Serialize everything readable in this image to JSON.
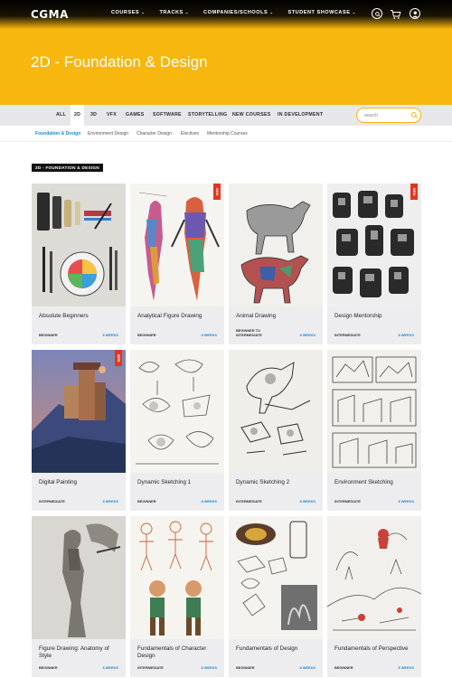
{
  "header": {
    "logo": "CGMA",
    "nav": [
      "COURSES",
      "TRACKS",
      "COMPANIES/SCHOOLS",
      "STUDENT SHOWCASE"
    ]
  },
  "hero": {
    "title": "2D - Foundation & Design"
  },
  "tabs": [
    "ALL",
    "2D",
    "3D",
    "VFX",
    "GAMES",
    "SOFTWARE",
    "STORYTELLING",
    "NEW COURSES",
    "IN DEVELOPMENT"
  ],
  "active_tab": "2D",
  "search": {
    "placeholder": "search"
  },
  "subtabs": [
    "Foundation & Design",
    "Environment Design",
    "Character Design",
    "Electives",
    "Mentorship Courses"
  ],
  "section_label": "2D - FOUNDATION & DESIGN",
  "badge_new": "NEW",
  "colors": {
    "accent": "#f8b70e",
    "link": "#1a8ad6",
    "new_badge": "#e5351f"
  },
  "courses": [
    {
      "title": "Absolute Beginners",
      "level": "BEGINNER",
      "duration": "8 WEEKS",
      "new": false
    },
    {
      "title": "Analytical Figure Drawing",
      "level": "BEGINNER",
      "duration": "8 WEEKS",
      "new": true
    },
    {
      "title": "Animal Drawing",
      "level": "BEGINNER TO INTERMEDIATE",
      "duration": "8 WEEKS",
      "new": false
    },
    {
      "title": "Design Mentorship",
      "level": "INTERMEDIATE",
      "duration": "8 WEEKS",
      "new": true
    },
    {
      "title": "Digital Painting",
      "level": "INTERMEDIATE",
      "duration": "8 WEEKS",
      "new": true
    },
    {
      "title": "Dynamic Sketching 1",
      "level": "BEGINNER",
      "duration": "8 WEEKS",
      "new": false
    },
    {
      "title": "Dynamic Sketching 2",
      "level": "INTERMEDIATE",
      "duration": "8 WEEKS",
      "new": false
    },
    {
      "title": "Environment Sketching",
      "level": "INTERMEDIATE",
      "duration": "8 WEEKS",
      "new": false
    },
    {
      "title": "Figure Drawing: Anatomy of Style",
      "level": "BEGINNER",
      "duration": "8 WEEKS",
      "new": false
    },
    {
      "title": "Fundamentals of Character Design",
      "level": "INTERMEDIATE",
      "duration": "8 WEEKS",
      "new": false
    },
    {
      "title": "Fundamentals of Design",
      "level": "BEGINNER",
      "duration": "8 WEEKS",
      "new": false
    },
    {
      "title": "Fundamentals of Perspective",
      "level": "BEGINNER",
      "duration": "8 WEEKS",
      "new": false
    }
  ]
}
